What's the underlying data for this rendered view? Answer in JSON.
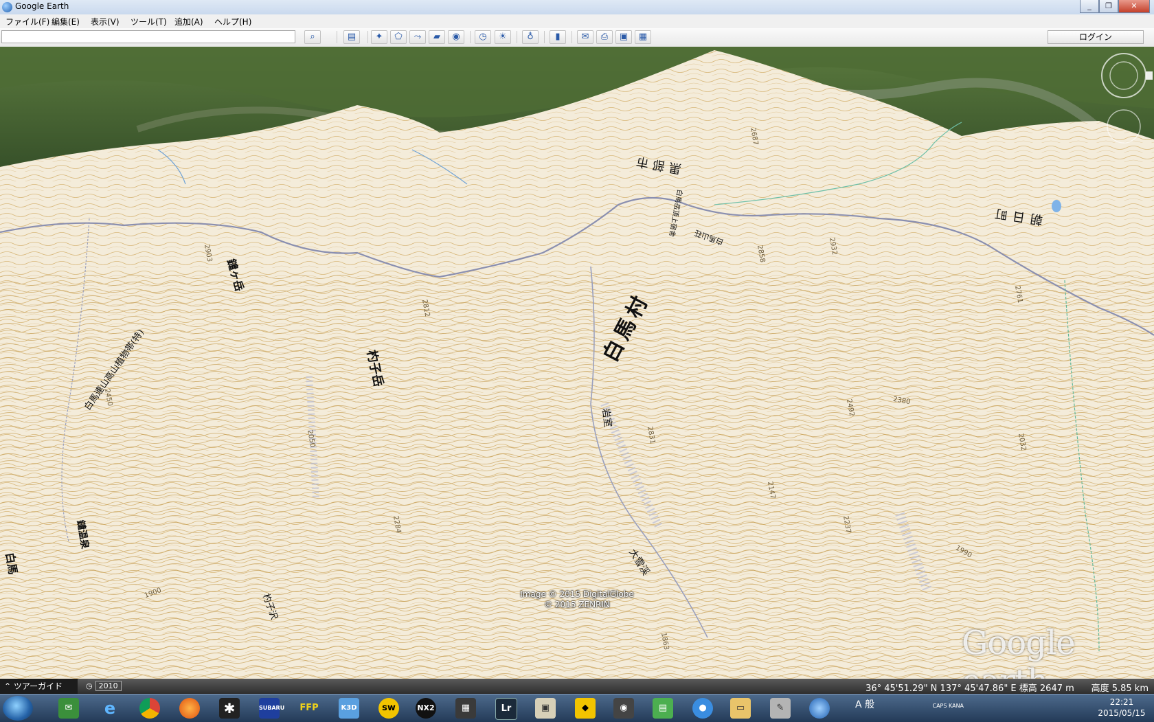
{
  "window": {
    "title": "Google Earth"
  },
  "menu": [
    "ファイル(F)",
    "編集(E)",
    "表示(V)",
    "ツール(T)",
    "追加(A)",
    "ヘルプ(H)"
  ],
  "toolbar": {
    "search_value": "",
    "login_label": "ログイン",
    "buttons": [
      "search-icon",
      "sidebar-icon",
      "placemark-icon",
      "polygon-icon",
      "path-icon",
      "overlay-icon",
      "tour-record-icon",
      "historical-imagery-icon",
      "sunlight-icon",
      "planets-icon",
      "ruler-icon",
      "email-icon",
      "print-icon",
      "save-image-icon",
      "maps-icon"
    ]
  },
  "map": {
    "labels": {
      "kurobe": "黒部市",
      "hakuba_village": "白馬村",
      "asahi": "朝日町",
      "yarigatake": "鑓ヶ岳",
      "shakushidake": "杓子岳",
      "iwamuro": "岩室",
      "hakuba_sansou": "白馬山荘",
      "hakuba_tyojo": "白馬岳頂上宿舎",
      "plants": "白馬連山高山植物帯(特)",
      "yari_onsen": "鑓温泉",
      "okusawa": "大雪渓",
      "shakusi_sawa": "杓子沢",
      "shiro": "白馬"
    },
    "elevations": [
      "2903",
      "2812",
      "2858",
      "2932",
      "2687",
      "2450",
      "2831",
      "2492",
      "2284",
      "2237",
      "2032",
      "1990",
      "1900",
      "2050",
      "1863",
      "2380",
      "2147",
      "2761"
    ],
    "credit_line1": "Image © 2015 DigitalGlobe",
    "credit_line2": "© 2015 ZENRIN",
    "logo": "Google earth"
  },
  "status": {
    "tour_guide": "ツアーガイド",
    "history_year": "2010",
    "coords": "36° 45'51.29\" N  137° 45'47.86\" E  標高  2647 m",
    "altitude": "高度   5.85 km"
  },
  "taskbar": {
    "apps": [
      "explorer-app",
      "ie-app",
      "chrome-app",
      "firefox-app",
      "app-asterisk",
      "subaru-app",
      "ftp-app",
      "k3d-app",
      "sw-app",
      "nx2-app",
      "photo-app",
      "lightroom-app",
      "photos-viewer-app",
      "nikon-app",
      "eye-app",
      "spreadsheet-app",
      "balloon-app",
      "folder-app",
      "paint-app",
      "google-earth-app"
    ],
    "tray": "A 般",
    "caps": "CAPS KANA",
    "time": "22:21",
    "date": "2015/05/15"
  },
  "colors": {
    "map_paper": "#f3ead6",
    "contour": "#c9a35a",
    "road": "#8a8fb0",
    "forest": "#3d5c2c"
  }
}
